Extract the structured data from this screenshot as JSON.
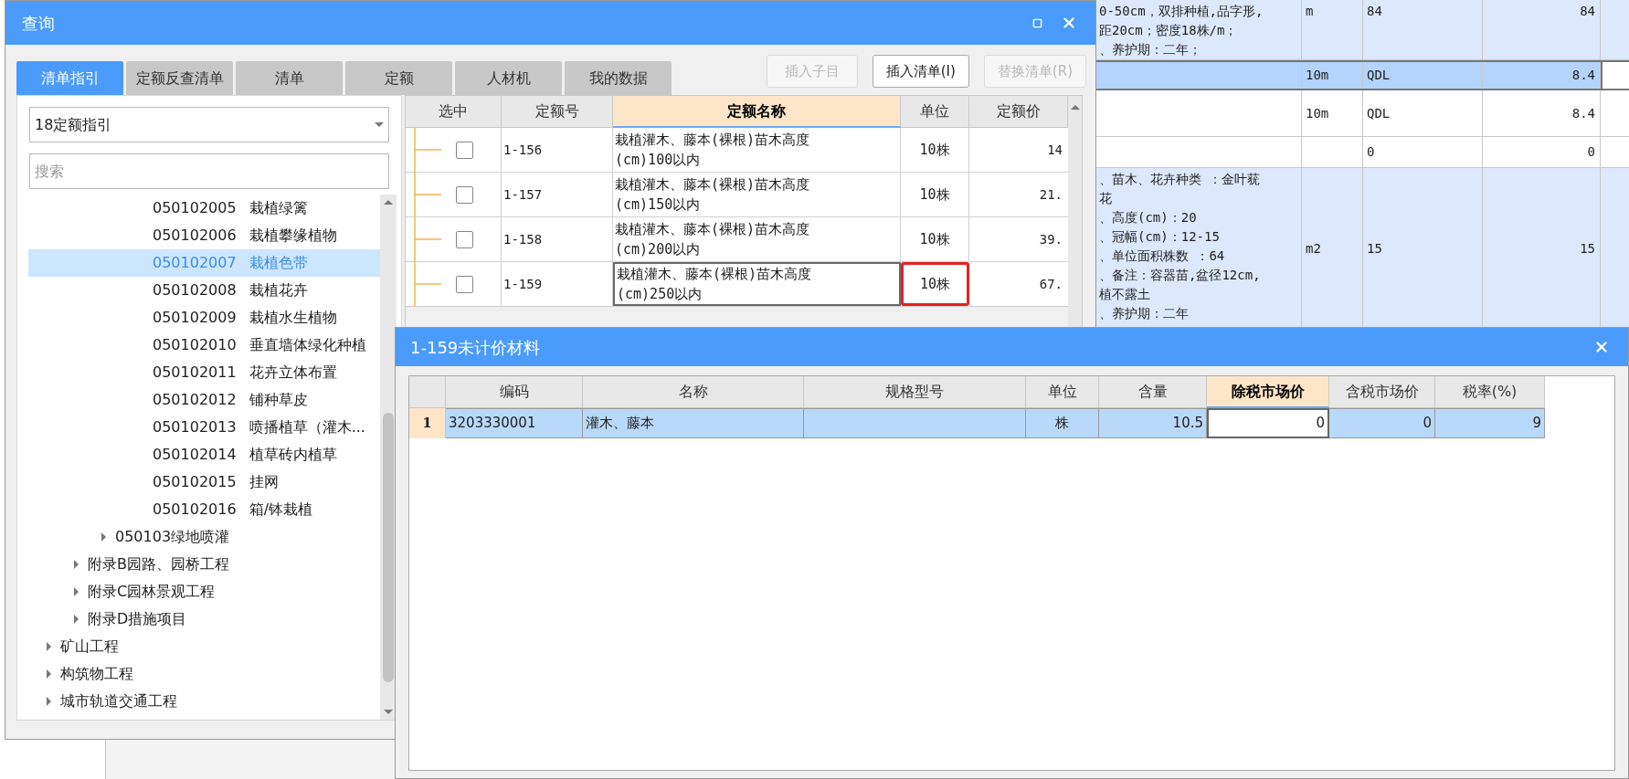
{
  "background_table": {
    "rows": [
      {
        "shaded": true,
        "selected": false,
        "description": [
          "0-50cm，双排种植,品字形,",
          "距20cm；密度18株/m；",
          "、养护期：二年；"
        ],
        "unit": "m",
        "column_3": "84",
        "column_4": "84"
      },
      {
        "selected": true,
        "unit": "10m",
        "column_3": "QDL",
        "column_4": "8.4"
      },
      {
        "shaded": false,
        "selected": false,
        "unit": "10m",
        "column_3": "QDL",
        "column_4": "8.4"
      },
      {
        "shaded": false,
        "selected": false,
        "column_3": "0",
        "column_4": "0"
      },
      {
        "shaded": true,
        "selected": false,
        "description": [
          "、苗木、花卉种类 ：金叶莸",
          "花",
          "、高度(cm)：20",
          "、冠幅(cm)：12-15",
          "、单位面积株数 ：64",
          "、备注：容器苗,盆径12cm,",
          "植不露土",
          "、养护期：二年"
        ],
        "unit": "m2",
        "column_3": "15",
        "column_4": "15"
      }
    ]
  },
  "query_dialog": {
    "title": "查询",
    "tabs": [
      {
        "label": "清单指引",
        "selected": true
      },
      {
        "label": "定额反查清单",
        "selected": false
      },
      {
        "label": "清单",
        "selected": false
      },
      {
        "label": "定额",
        "selected": false
      },
      {
        "label": "人材机",
        "selected": false
      },
      {
        "label": "我的数据",
        "selected": false
      }
    ],
    "buttons": [
      {
        "label": "插入子目",
        "disabled": true
      },
      {
        "label": "插入清单(I)",
        "disabled": false
      },
      {
        "label": "替换清单(R)",
        "disabled": true
      }
    ],
    "guide_select": {
      "value": "18定额指引"
    },
    "search": {
      "placeholder": "搜索"
    },
    "tree": {
      "items": [
        {
          "children": [
            {
              "children": [
                {
                  "children": [
                    {
                      "code": "050102005",
                      "name": "栽植绿篱",
                      "selected": false
                    },
                    {
                      "code": "050102006",
                      "name": "栽植攀缘植物",
                      "selected": false
                    },
                    {
                      "code": "050102007",
                      "name": "栽植色带",
                      "selected": true
                    },
                    {
                      "code": "050102008",
                      "name": "栽植花卉",
                      "selected": false
                    },
                    {
                      "code": "050102009",
                      "name": "栽植水生植物",
                      "selected": false
                    },
                    {
                      "code": "050102010",
                      "name": "垂直墙体绿化种植",
                      "selected": false
                    },
                    {
                      "code": "050102011",
                      "name": "花卉立体布置",
                      "selected": false
                    },
                    {
                      "code": "050102012",
                      "name": "铺种草皮",
                      "selected": false
                    },
                    {
                      "code": "050102013",
                      "name": "喷播植草（灌木...",
                      "selected": false
                    },
                    {
                      "code": "050102014",
                      "name": "植草砖内植草",
                      "selected": false
                    },
                    {
                      "code": "050102015",
                      "name": "挂网",
                      "selected": false
                    },
                    {
                      "code": "050102016",
                      "name": "箱/钵栽植",
                      "selected": false
                    }
                  ]
                },
                {
                  "label": "050103绿地喷灌",
                  "expanded": false
                }
              ]
            },
            {
              "label": "附录B园路、园桥工程",
              "expanded": false
            },
            {
              "label": "附录C园林景观工程",
              "expanded": false
            },
            {
              "label": "附录D措施项目",
              "expanded": false
            }
          ]
        },
        {
          "label": "矿山工程",
          "expanded": false
        },
        {
          "label": "构筑物工程",
          "expanded": false
        },
        {
          "label": "城市轨道交通工程",
          "expanded": false
        }
      ]
    },
    "quota_table": {
      "columns": [
        {
          "label": "选中",
          "highlighted": false
        },
        {
          "label": "定额号",
          "highlighted": false
        },
        {
          "label": "定额名称",
          "highlighted": true
        },
        {
          "label": "单位",
          "highlighted": false
        },
        {
          "label": "定额价",
          "highlighted": false
        }
      ],
      "rows": [
        {
          "checked": false,
          "selected": false,
          "unit_marked": false,
          "code": "1-156",
          "name": [
            "栽植灌木、藤本(裸根)苗木高度",
            "(cm)100以内"
          ],
          "unit": "10株",
          "price": "14"
        },
        {
          "checked": false,
          "selected": false,
          "unit_marked": false,
          "code": "1-157",
          "name": [
            "栽植灌木、藤本(裸根)苗木高度",
            "(cm)150以内"
          ],
          "unit": "10株",
          "price": "21."
        },
        {
          "checked": false,
          "selected": false,
          "unit_marked": false,
          "code": "1-158",
          "name": [
            "栽植灌木、藤本(裸根)苗木高度",
            "(cm)200以内"
          ],
          "unit": "10株",
          "price": "39."
        },
        {
          "checked": false,
          "selected": true,
          "unit_marked": true,
          "code": "1-159",
          "name": [
            "栽植灌木、藤本(裸根)苗木高度",
            "(cm)250以内"
          ],
          "unit": "10株",
          "price": "67."
        }
      ]
    }
  },
  "materials_dialog": {
    "title": "1-159未计价材料",
    "columns": [
      {
        "label": "编码",
        "highlighted": false
      },
      {
        "label": "名称",
        "highlighted": false
      },
      {
        "label": "规格型号",
        "highlighted": false
      },
      {
        "label": "单位",
        "highlighted": false
      },
      {
        "label": "含量",
        "highlighted": false
      },
      {
        "label": "除税市场价",
        "highlighted": true
      },
      {
        "label": "含税市场价",
        "highlighted": false
      },
      {
        "label": "税率(%)",
        "highlighted": false
      }
    ],
    "rows": [
      {
        "number": "1",
        "code": "3203330001",
        "name": "灌木、藤本",
        "unit": "株",
        "quantity": "10.5",
        "price_ex_tax": "0",
        "price_inc_tax": "0",
        "tax_rate": "9"
      }
    ]
  }
}
